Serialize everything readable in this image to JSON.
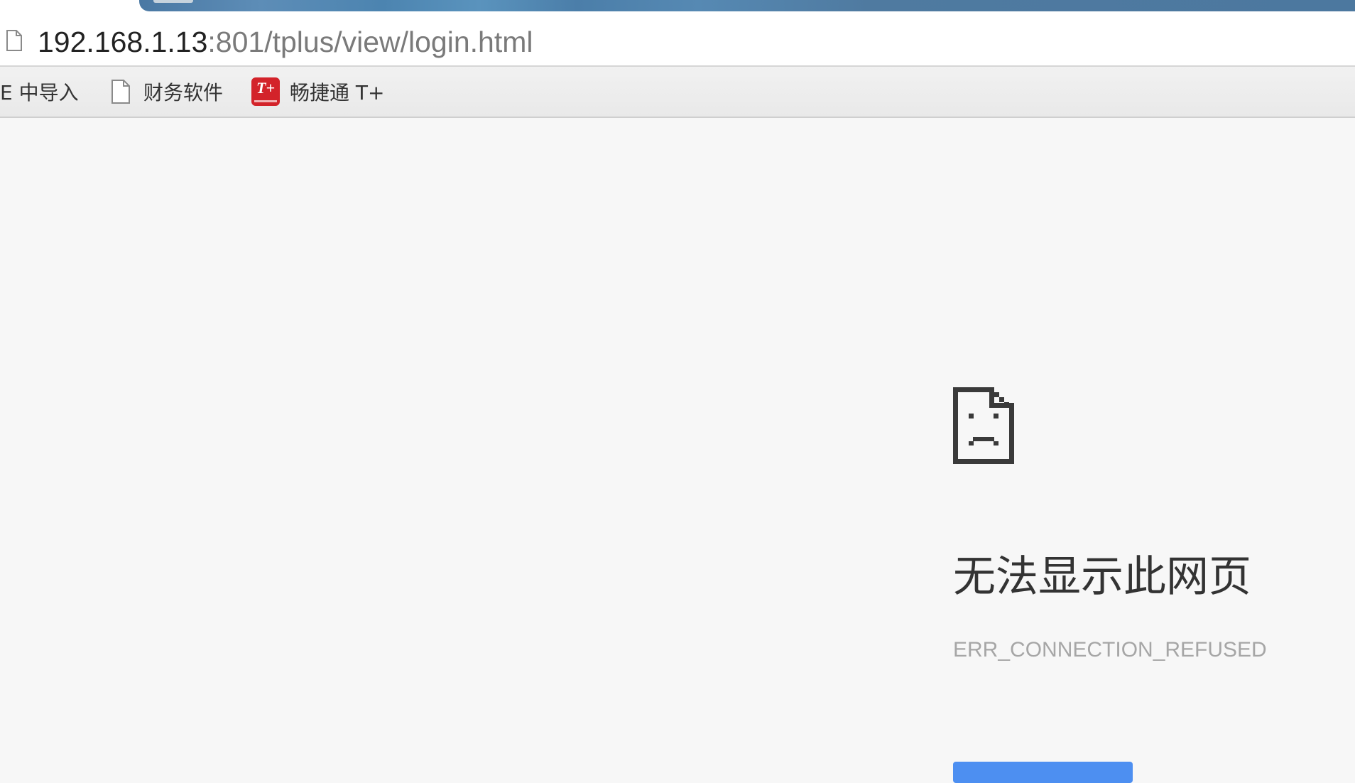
{
  "omnibox": {
    "url_host": "192.168.1.13",
    "url_path": ":801/tplus/view/login.html"
  },
  "bookmarks": {
    "items": [
      {
        "label": "E 中导入",
        "icon": "none"
      },
      {
        "label": "财务软件",
        "icon": "page-icon"
      },
      {
        "label": "畅捷通 T+",
        "icon": "tplus-logo-icon",
        "icon_text": "T+"
      }
    ]
  },
  "error": {
    "icon": "sad-page-icon",
    "title": "无法显示此网页",
    "code": "ERR_CONNECTION_REFUSED"
  },
  "colors": {
    "page_background": "#f7f7f7",
    "button_blue": "#4d8ff1",
    "tplus_red": "#d3232a"
  }
}
